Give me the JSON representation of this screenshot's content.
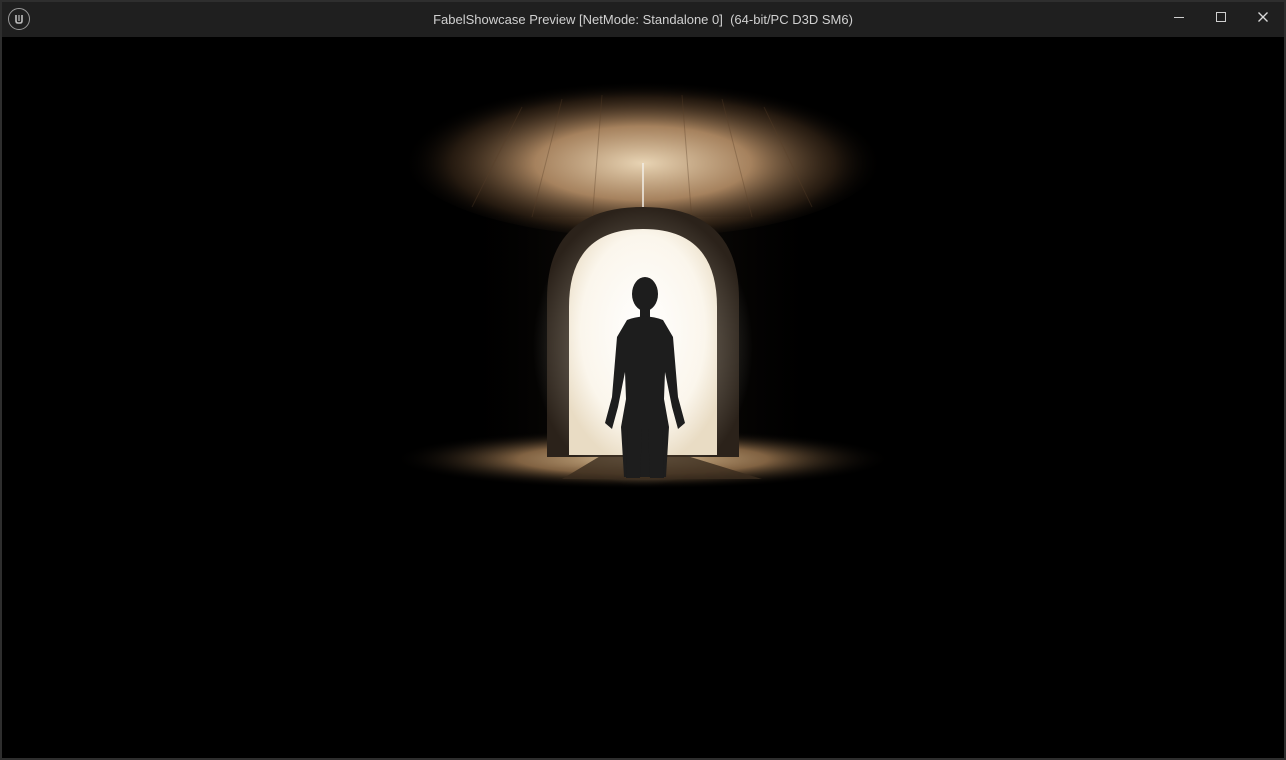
{
  "window": {
    "title": "FabelShowcase Preview [NetMode: Standalone 0]  (64-bit/PC D3D SM6)",
    "logo_icon": "unreal-engine-logo-icon",
    "controls": [
      {
        "name": "minimize-button",
        "icon": "minimize-icon"
      },
      {
        "name": "maximize-button",
        "icon": "maximize-icon"
      },
      {
        "name": "close-button",
        "icon": "close-icon"
      }
    ]
  },
  "viewport": {
    "scene": "silhouette-in-lit-archway",
    "colors": {
      "background": "#000000",
      "light_warm": "#c9a87c",
      "doorway_glow": "#fffdf6",
      "titlebar": "#1f1f1f",
      "title_text": "#d0d0d0"
    }
  }
}
